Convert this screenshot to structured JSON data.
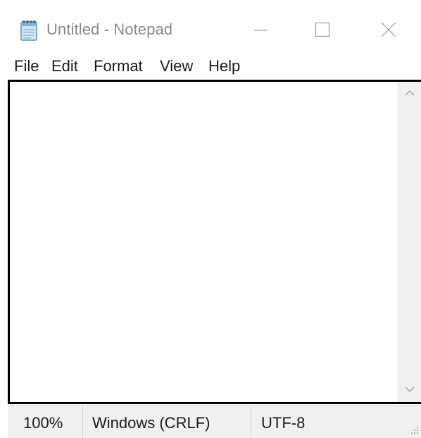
{
  "window": {
    "app_icon": "notepad-icon",
    "title": "Untitled - Notepad",
    "controls": {
      "minimize_icon": "minimize-icon",
      "maximize_icon": "maximize-icon",
      "close_icon": "close-icon"
    }
  },
  "menu": {
    "items": [
      {
        "label": "File"
      },
      {
        "label": "Edit"
      },
      {
        "label": "Format"
      },
      {
        "label": "View"
      },
      {
        "label": "Help"
      }
    ]
  },
  "editor": {
    "content": "",
    "scroll_up_icon": "chevron-up-icon",
    "scroll_down_icon": "chevron-down-icon"
  },
  "status": {
    "zoom": "100%",
    "line_ending": "Windows (CRLF)",
    "encoding": "UTF-8",
    "grip_icon": "resize-grip-icon"
  },
  "colors": {
    "title_text": "#8a8a8a",
    "menu_text": "#1a1a1a",
    "editor_border": "#000000",
    "scrollbar_bg": "#f0f0f0",
    "statusbar_bg": "#f0f0f0"
  }
}
